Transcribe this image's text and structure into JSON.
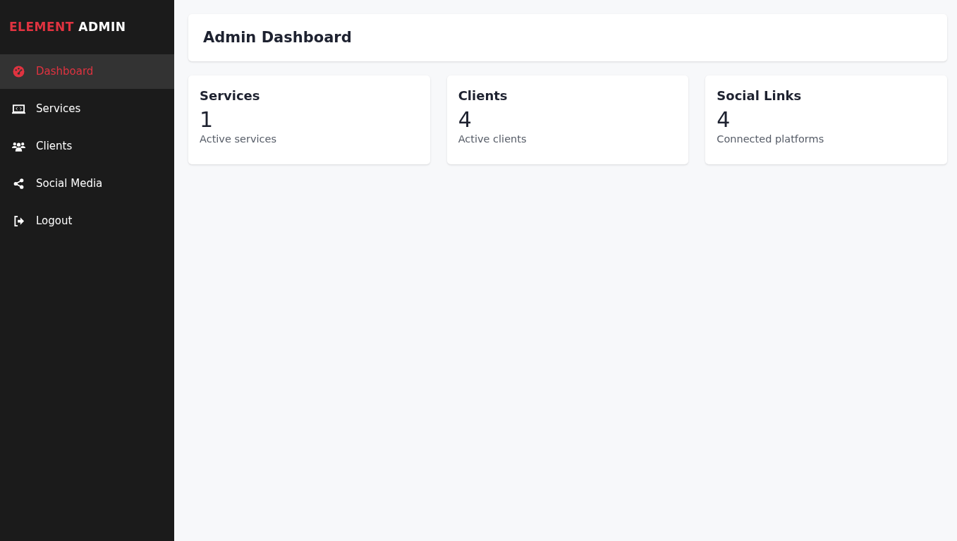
{
  "logo": {
    "accent": "ELEMENT",
    "text": "ADMIN"
  },
  "sidebar": {
    "items": [
      {
        "label": "Dashboard",
        "selected": true
      },
      {
        "label": "Services",
        "selected": false
      },
      {
        "label": "Clients",
        "selected": false
      },
      {
        "label": "Social Media",
        "selected": false
      },
      {
        "label": "Logout",
        "selected": false
      }
    ]
  },
  "header": {
    "title": "Admin Dashboard"
  },
  "cards": [
    {
      "title": "Services",
      "value": "1",
      "caption": "Active services"
    },
    {
      "title": "Clients",
      "value": "4",
      "caption": "Active clients"
    },
    {
      "title": "Social Links",
      "value": "4",
      "caption": "Connected platforms"
    }
  ]
}
